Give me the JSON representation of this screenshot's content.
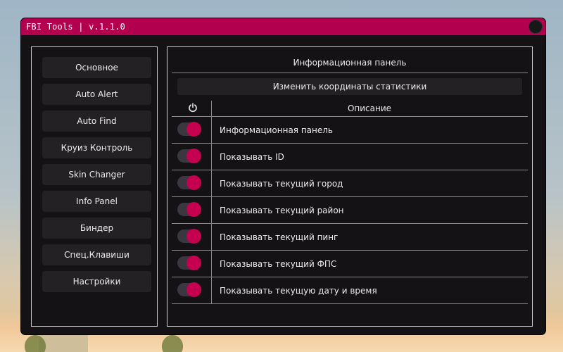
{
  "window": {
    "title": "FBI Tools | v.1.1.0"
  },
  "sidebar": {
    "items": [
      {
        "label": "Основное"
      },
      {
        "label": "Auto Alert"
      },
      {
        "label": "Auto Find"
      },
      {
        "label": "Круиз Контроль"
      },
      {
        "label": "Skin Changer"
      },
      {
        "label": "Info Panel"
      },
      {
        "label": "Биндер"
      },
      {
        "label": "Спец.Клавиши"
      },
      {
        "label": "Настройки"
      }
    ]
  },
  "main": {
    "title": "Информационная панель",
    "coords_button": "Изменить координаты статистики",
    "table": {
      "toggle_column_icon": "power-icon",
      "description_header": "Описание",
      "rows": [
        {
          "label": "Информационная панель",
          "enabled": true
        },
        {
          "label": "Показывать ID",
          "enabled": true
        },
        {
          "label": "Показывать текущий город",
          "enabled": true
        },
        {
          "label": "Показывать текущий район",
          "enabled": true
        },
        {
          "label": "Показывать текущий пинг",
          "enabled": true
        },
        {
          "label": "Показывать текущий ФПС",
          "enabled": true
        },
        {
          "label": "Показывать текущую дату и время",
          "enabled": true
        }
      ]
    }
  },
  "colors": {
    "accent": "#b3004e",
    "toggle_knob": "#c4004f",
    "window_bg": "#141214",
    "button_bg": "#232123"
  }
}
